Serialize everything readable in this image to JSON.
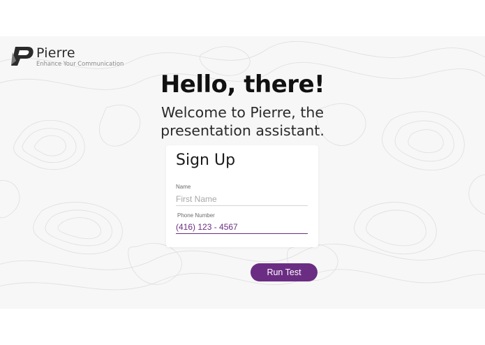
{
  "brand": {
    "name": "Pierre",
    "tagline": "Enhance Your Communication",
    "logo_icon": "speech-bubble-p-logo"
  },
  "hero": {
    "title": "Hello, there!",
    "subtitle_line1": "Welcome to Pierre, the",
    "subtitle_line2": "presentation assistant."
  },
  "signup": {
    "title": "Sign Up",
    "name_label": "Name",
    "name_placeholder": "First Name",
    "name_value": "",
    "phone_label": "Phone Number",
    "phone_value": "(416) 123 - 4567"
  },
  "actions": {
    "run_test_label": "Run Test"
  },
  "colors": {
    "accent": "#6b2d83",
    "background_pattern": "#f7f7f7",
    "text_dark": "#111111"
  }
}
